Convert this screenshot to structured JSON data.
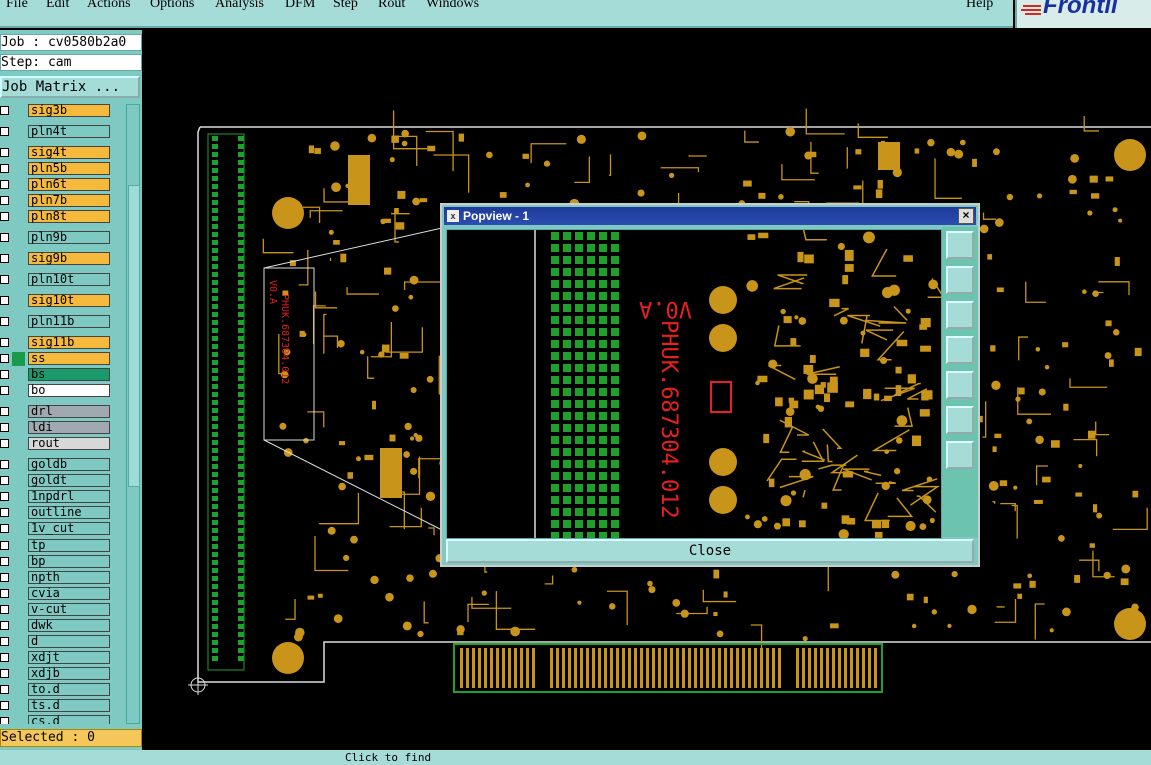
{
  "menu": {
    "items": [
      "File",
      "Edit",
      "Actions",
      "Options",
      "Analysis",
      "DFM",
      "Step",
      "Rout",
      "Windows"
    ],
    "help": "Help"
  },
  "logo": {
    "text": "Frontli"
  },
  "info": {
    "job": "Job : cv0580b2a0",
    "step": "Step: cam"
  },
  "job_matrix_label": "Job Matrix ...",
  "layers": [
    {
      "name": "sig3b",
      "color": "#f5b93b"
    },
    {
      "name": "pln4t",
      "color": "#7ec9c2"
    },
    {
      "name": "sig4t",
      "color": "#f5b93b"
    },
    {
      "name": "pln5b",
      "color": "#f5b93b"
    },
    {
      "name": "pln6t",
      "color": "#f5b93b"
    },
    {
      "name": "pln7b",
      "color": "#f5b93b"
    },
    {
      "name": "pln8t",
      "color": "#f5b93b"
    },
    {
      "name": "pln9b",
      "color": "#7ec9c2"
    },
    {
      "name": "sig9b",
      "color": "#f5b93b"
    },
    {
      "name": "pln10t",
      "color": "#7ec9c2"
    },
    {
      "name": "sig10t",
      "color": "#f5b93b"
    },
    {
      "name": "pln11b",
      "color": "#7ec9c2"
    },
    {
      "name": "sig11b",
      "color": "#f5b93b"
    },
    {
      "name": "ss",
      "color": "#f5b93b"
    },
    {
      "name": "bs",
      "color": "#1a9a6a"
    },
    {
      "name": "bo",
      "color": "#ffffff"
    },
    {
      "name": "drl",
      "color": "#a0a8b0"
    },
    {
      "name": "ldi",
      "color": "#a0a8b0"
    },
    {
      "name": "rout",
      "color": "#d8d8d8"
    },
    {
      "name": "goldb",
      "color": "#7ec9c2"
    },
    {
      "name": "goldt",
      "color": "#7ec9c2"
    },
    {
      "name": "1npdrl",
      "color": "#7ec9c2"
    },
    {
      "name": "outline",
      "color": "#7ec9c2"
    },
    {
      "name": "1v_cut",
      "color": "#7ec9c2"
    },
    {
      "name": "tp",
      "color": "#7ec9c2"
    },
    {
      "name": "bp",
      "color": "#7ec9c2"
    },
    {
      "name": "npth",
      "color": "#7ec9c2"
    },
    {
      "name": "cvia",
      "color": "#7ec9c2"
    },
    {
      "name": "v-cut",
      "color": "#7ec9c2"
    },
    {
      "name": "dwk",
      "color": "#7ec9c2"
    },
    {
      "name": "d",
      "color": "#7ec9c2"
    },
    {
      "name": "xdjt",
      "color": "#7ec9c2"
    },
    {
      "name": "xdjb",
      "color": "#7ec9c2"
    },
    {
      "name": "to.d",
      "color": "#7ec9c2"
    },
    {
      "name": "ts.d",
      "color": "#7ec9c2"
    },
    {
      "name": "cs.d",
      "color": "#7ec9c2"
    }
  ],
  "selected_text": "Selected : 0",
  "popup": {
    "title": "Popview - 1",
    "close_label": "Close",
    "silk_text_1": "V0.A",
    "silk_text_2": "PHUK.687304.012"
  },
  "status_text": "Click to find"
}
